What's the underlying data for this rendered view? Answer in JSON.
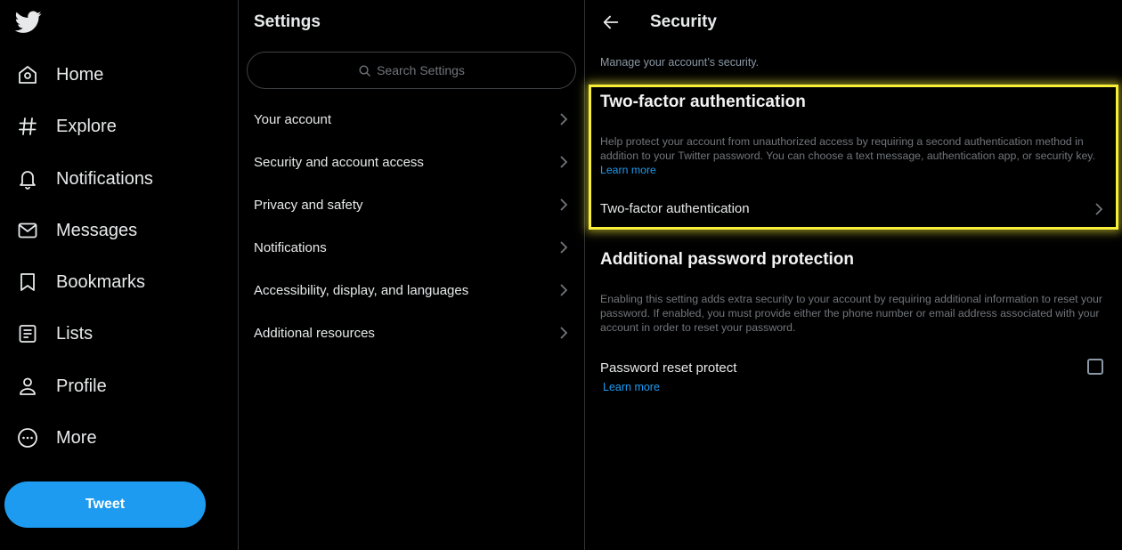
{
  "nav": {
    "items": [
      {
        "label": "Home",
        "icon": "home-icon"
      },
      {
        "label": "Explore",
        "icon": "hashtag-icon"
      },
      {
        "label": "Notifications",
        "icon": "bell-icon"
      },
      {
        "label": "Messages",
        "icon": "envelope-icon"
      },
      {
        "label": "Bookmarks",
        "icon": "bookmark-icon"
      },
      {
        "label": "Lists",
        "icon": "list-icon"
      },
      {
        "label": "Profile",
        "icon": "person-icon"
      },
      {
        "label": "More",
        "icon": "more-circle-icon"
      }
    ],
    "tweet_label": "Tweet"
  },
  "settings": {
    "title": "Settings",
    "search_placeholder": "Search Settings",
    "items": [
      {
        "label": "Your account"
      },
      {
        "label": "Security and account access"
      },
      {
        "label": "Privacy and safety"
      },
      {
        "label": "Notifications"
      },
      {
        "label": "Accessibility, display, and languages"
      },
      {
        "label": "Additional resources"
      }
    ]
  },
  "security": {
    "title": "Security",
    "subtitle": "Manage your account’s security.",
    "tfa": {
      "heading": "Two-factor authentication",
      "description": "Help protect your account from unauthorized access by requiring a second authentication method in addition to your Twitter password. You can choose a text message, authentication app, or security key.",
      "learn_more": "Learn more",
      "row_label": "Two-factor authentication"
    },
    "app": {
      "heading": "Additional password protection",
      "description": "Enabling this setting adds extra security to your account by requiring additional information to reset your password. If enabled, you must provide either the phone number or email address associated with your account in order to reset your password.",
      "row_label": "Password reset protect",
      "learn_more": "Learn more",
      "checked": false
    }
  },
  "colors": {
    "accent": "#1d9bf0",
    "highlight": "#f7ee3a",
    "background": "#000000"
  }
}
